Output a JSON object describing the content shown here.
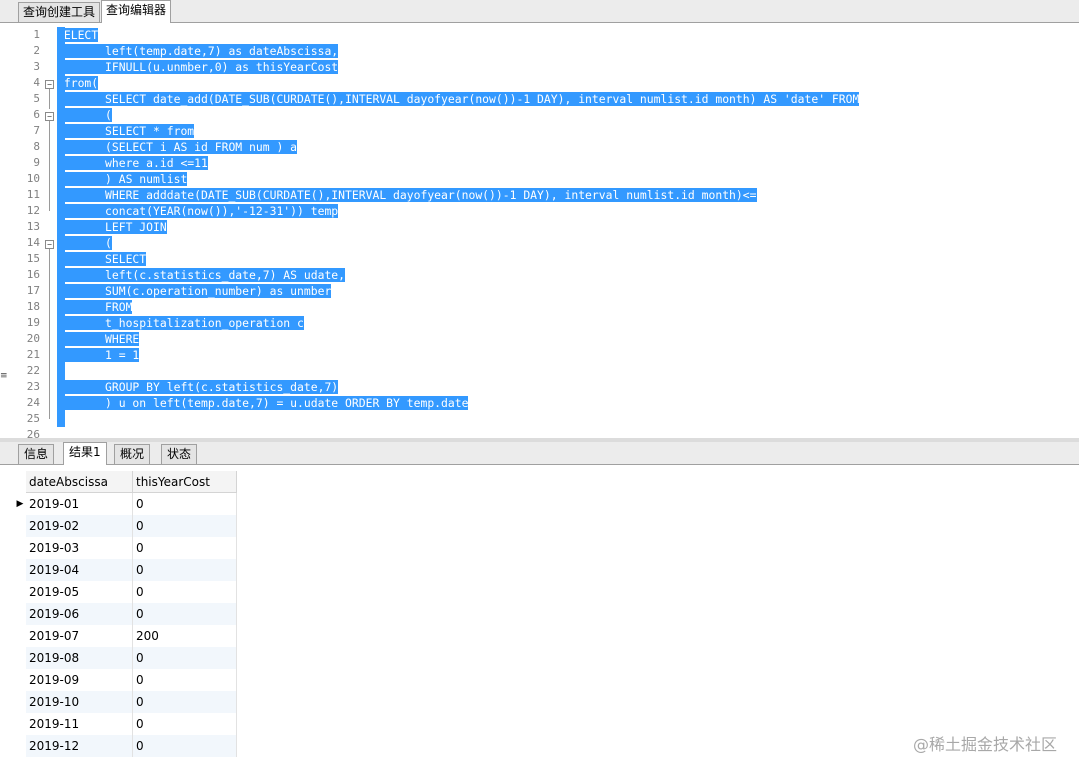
{
  "top_tabs": [
    "查询创建工具",
    "查询编辑器"
  ],
  "top_active": 1,
  "editor": {
    "lines": [
      "SELECT",
      "       left(temp.date,7) as dateAbscissa,",
      "       IFNULL(u.unmber,0) as thisYearCost",
      " from(",
      "       SELECT date_add(DATE_SUB(CURDATE(),INTERVAL dayofyear(now())-1 DAY), interval numlist.id month) AS 'date' FROM",
      "       (",
      "       SELECT * from",
      "       (SELECT i AS id FROM num ) a",
      "       where a.id <=11",
      "       ) AS numlist",
      "       WHERE adddate(DATE_SUB(CURDATE(),INTERVAL dayofyear(now())-1 DAY), interval numlist.id month)<=",
      "       concat(YEAR(now()),'-12-31')) temp",
      "       LEFT JOIN",
      "       (",
      "       SELECT",
      "       left(c.statistics_date,7) AS udate,",
      "       SUM(c.operation_number) as unmber",
      "       FROM",
      "       t_hospitalization_operation c",
      "       WHERE",
      "       1 = 1",
      "",
      "       GROUP BY left(c.statistics_date,7)",
      "       ) u on left(temp.date,7) = u.udate ORDER BY temp.date",
      "",
      ""
    ],
    "line_numbers": [
      "1",
      "2",
      "3",
      "4",
      "5",
      "6",
      "7",
      "8",
      "9",
      "10",
      "11",
      "12",
      "13",
      "14",
      "15",
      "16",
      "17",
      "18",
      "19",
      "20",
      "21",
      "22",
      "23",
      "24",
      "25",
      "26"
    ]
  },
  "bottom_tabs": [
    "信息",
    "结果1",
    "概况",
    "状态"
  ],
  "bottom_active": 1,
  "results": {
    "columns": [
      "dateAbscissa",
      "thisYearCost"
    ],
    "rows": [
      [
        "2019-01",
        "0"
      ],
      [
        "2019-02",
        "0"
      ],
      [
        "2019-03",
        "0"
      ],
      [
        "2019-04",
        "0"
      ],
      [
        "2019-05",
        "0"
      ],
      [
        "2019-06",
        "0"
      ],
      [
        "2019-07",
        "200"
      ],
      [
        "2019-08",
        "0"
      ],
      [
        "2019-09",
        "0"
      ],
      [
        "2019-10",
        "0"
      ],
      [
        "2019-11",
        "0"
      ],
      [
        "2019-12",
        "0"
      ]
    ],
    "current_row_indicator": "▶"
  },
  "watermark": "@稀土掘金技术社区"
}
